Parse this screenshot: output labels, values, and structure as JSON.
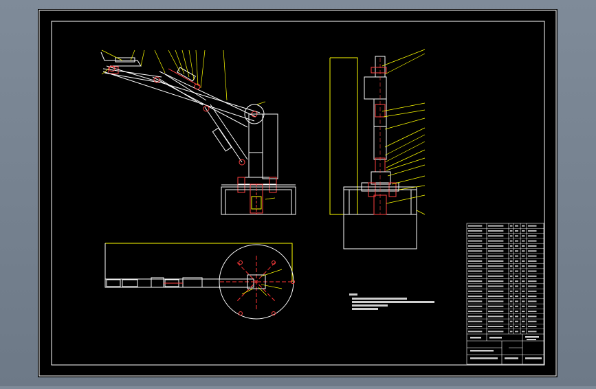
{
  "colors": {
    "background": "#76828f",
    "paper": "#000000",
    "frame": "#ffffff",
    "part": "#ffffff",
    "leader": "#ffff00",
    "hidden": "#ff3333",
    "centerline": "#ff0000",
    "table_text": "#d8d8d8"
  },
  "icons": [
    "cad-drawing-sheet",
    "robot-arm-side-view",
    "robot-arm-front-view",
    "robot-arm-top-view",
    "parts-list-table",
    "title-block"
  ],
  "views": {
    "side": "side-elevation",
    "front": "front-elevation",
    "top": "plan-view"
  },
  "parts_list": {
    "rows": 22,
    "columns": 7
  }
}
